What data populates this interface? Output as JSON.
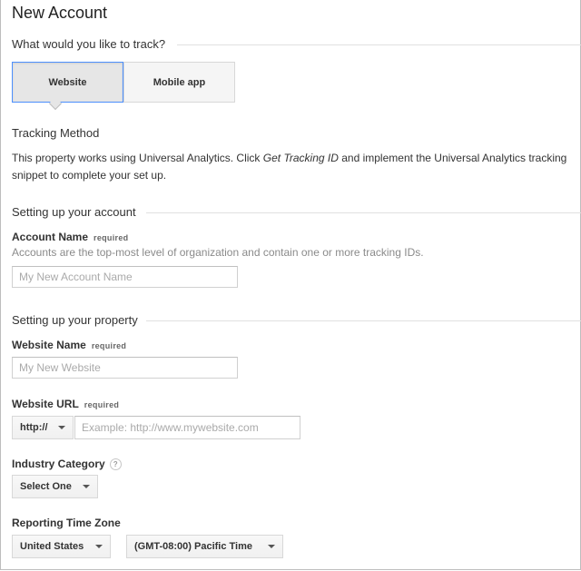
{
  "page": {
    "title": "New Account"
  },
  "track": {
    "heading": "What would you like to track?",
    "options": [
      {
        "label": "Website",
        "selected": true
      },
      {
        "label": "Mobile app",
        "selected": false
      }
    ]
  },
  "tracking_method": {
    "heading": "Tracking Method",
    "text_before": "This property works using Universal Analytics. Click ",
    "text_link": "Get Tracking ID",
    "text_after": " and implement the Universal Analytics tracking",
    "text_line2": "snippet to complete your set up."
  },
  "account": {
    "heading": "Setting up your account",
    "name_label": "Account Name",
    "required": "required",
    "hint": "Accounts are the top-most level of organization and contain one or more tracking IDs.",
    "name_placeholder": "My New Account Name"
  },
  "property": {
    "heading": "Setting up your property",
    "website_name_label": "Website Name",
    "website_name_placeholder": "My New Website",
    "website_url_label": "Website URL",
    "protocol_value": "http://",
    "url_placeholder": "Example: http://www.mywebsite.com",
    "industry_label": "Industry Category",
    "industry_help": "?",
    "industry_value": "Select One",
    "timezone_label": "Reporting Time Zone",
    "country_value": "United States",
    "timezone_value": "(GMT-08:00) Pacific Time"
  },
  "colors": {
    "selected_border": "#4d90fe",
    "hint_text": "#8a8a8a",
    "rule": "#e0e0e0"
  },
  "icons": {
    "help": "help-icon",
    "caret": "chevron-down-icon"
  }
}
